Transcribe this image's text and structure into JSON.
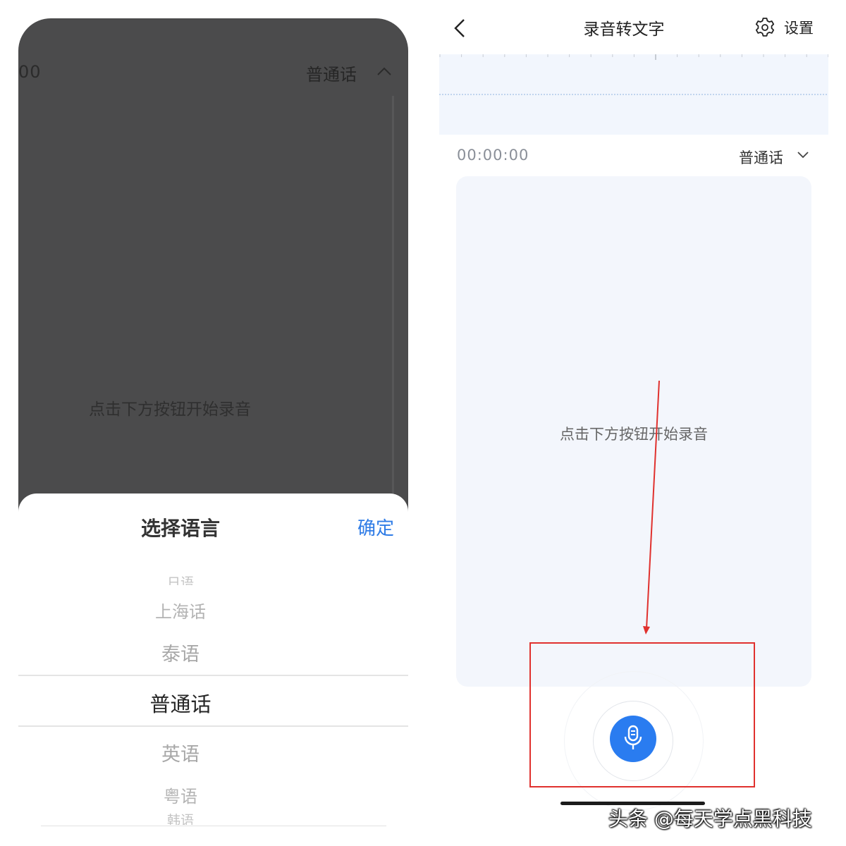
{
  "left": {
    "time": "00",
    "language": "普通话",
    "hint": "点击下方按钮开始录音",
    "sheet": {
      "title": "选择语言",
      "confirm": "确定",
      "options": [
        "日语",
        "上海话",
        "泰语",
        "普通话",
        "英语",
        "粤语",
        "韩语"
      ],
      "selected": "普通话"
    }
  },
  "right": {
    "title": "录音转文字",
    "settings": "设置",
    "time": "00:00:00",
    "language": "普通话",
    "hint": "点击下方按钮开始录音"
  },
  "watermark": "头条 @每天学点黑科技",
  "colors": {
    "accent": "#2a7cf0",
    "confirm": "#2f7ce6",
    "annotation": "#e0312e",
    "overlay": "#4b4b4c"
  },
  "icons": [
    "chevron-up-icon",
    "back-arrow-icon",
    "gear-icon",
    "chevron-down-icon",
    "microphone-icon"
  ]
}
